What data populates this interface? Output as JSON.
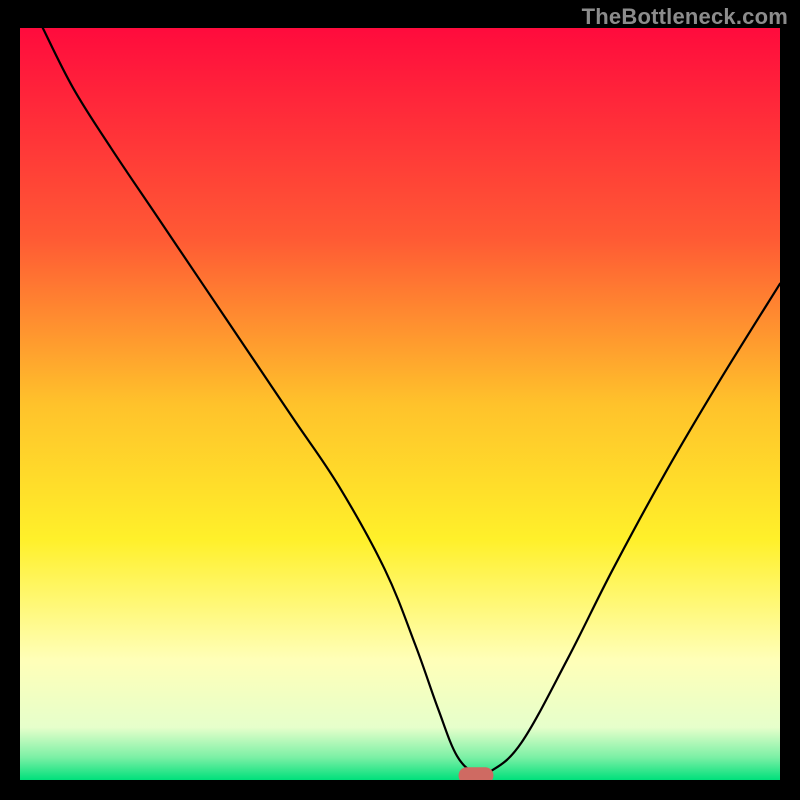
{
  "watermark": "TheBottleneck.com",
  "chart_data": {
    "type": "line",
    "title": "",
    "xlabel": "",
    "ylabel": "",
    "xlim": [
      0,
      100
    ],
    "ylim": [
      0,
      100
    ],
    "grid": false,
    "legend": false,
    "background": {
      "type": "vertical_gradient",
      "stops": [
        {
          "y": 0,
          "color": "#ff0b3d"
        },
        {
          "y": 28,
          "color": "#ff5a34"
        },
        {
          "y": 50,
          "color": "#ffc22b"
        },
        {
          "y": 68,
          "color": "#fff02a"
        },
        {
          "y": 84,
          "color": "#ffffb8"
        },
        {
          "y": 93,
          "color": "#e6ffcb"
        },
        {
          "y": 97,
          "color": "#7bf0a5"
        },
        {
          "y": 100,
          "color": "#00e07b"
        }
      ]
    },
    "series": [
      {
        "name": "bottleneck_curve",
        "color": "#000000",
        "stroke_width": 2.2,
        "x": [
          3,
          7,
          12,
          18,
          24,
          30,
          36,
          42,
          48,
          52,
          55,
          57.5,
          60,
          62,
          66,
          72,
          78,
          85,
          92,
          100
        ],
        "y": [
          100,
          92,
          84,
          75,
          66,
          57,
          48,
          39,
          28,
          18,
          9.5,
          3.2,
          0.9,
          1.2,
          5,
          16,
          28,
          41,
          53,
          66
        ]
      }
    ],
    "markers": [
      {
        "name": "optimal_point",
        "shape": "rounded_rect",
        "cx": 60,
        "cy": 0.6,
        "w": 4.6,
        "h": 2.2,
        "rx": 1.1,
        "color": "#cf6a62"
      }
    ]
  }
}
